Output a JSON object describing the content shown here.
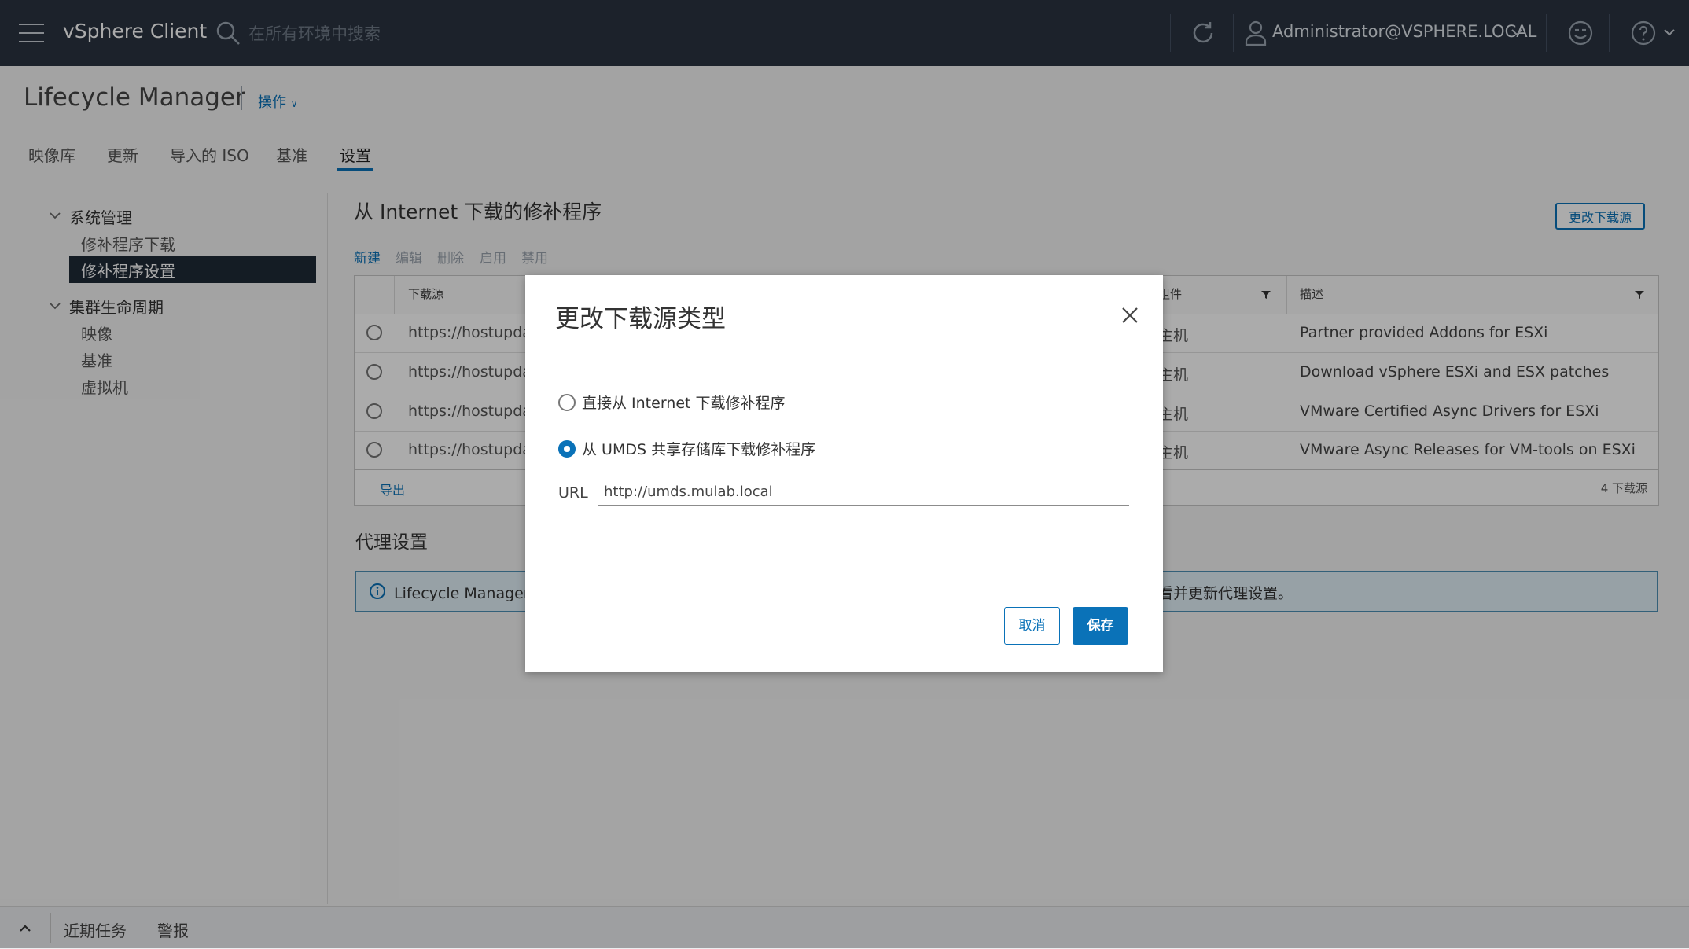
{
  "header": {
    "app_title": "vSphere Client",
    "search_placeholder": "在所有环境中搜索",
    "user": "Administrator@VSPHERE.LOCAL"
  },
  "page": {
    "title": "Lifecycle Manager",
    "actions_label": "操作",
    "tabs": [
      "映像库",
      "更新",
      "导入的 ISO",
      "基准",
      "设置"
    ],
    "active_tab": "设置"
  },
  "sidebar": {
    "groups": [
      {
        "label": "系统管理",
        "items": [
          "修补程序下载",
          "修补程序设置"
        ]
      },
      {
        "label": "集群生命周期",
        "items": [
          "映像",
          "基准",
          "虚拟机"
        ]
      }
    ],
    "selected": "修补程序设置"
  },
  "main": {
    "section_title": "从 Internet 下载的修补程序",
    "change_source_button": "更改下载源",
    "toolbar": [
      "新建",
      "编辑",
      "删除",
      "启用",
      "禁用"
    ],
    "grid": {
      "columns": [
        "下载源",
        "组件",
        "描述"
      ],
      "rows": [
        {
          "url": "https://hostupdate",
          "target": "主机",
          "description": "Partner provided Addons for ESXi"
        },
        {
          "url": "https://hostupdate",
          "target": "主机",
          "description": "Download vSphere ESXi and ESX patches"
        },
        {
          "url": "https://hostupdate",
          "target": "主机",
          "description": "VMware Certified Async Drivers for ESXi"
        },
        {
          "url": "https://hostupdate",
          "target": "主机",
          "description": "VMware Async Releases for VM-tools on ESXi"
        }
      ],
      "export_label": "导出",
      "count_label": "4 下载源"
    },
    "proxy_title": "代理设置",
    "proxy_alert_start": "Lifecycle Manager 现",
    "proxy_alert_end": "看并更新代理设置。"
  },
  "bottom": {
    "recent_tasks": "近期任务",
    "alarms": "警报"
  },
  "dialog": {
    "title": "更改下载源类型",
    "option_internet": "直接从 Internet 下载修补程序",
    "option_umds": "从 UMDS 共享存储库下载修补程序",
    "selected_option": "umds",
    "url_label": "URL",
    "url_value": "http://umds.mulab.local",
    "cancel_label": "取消",
    "save_label": "保存"
  }
}
